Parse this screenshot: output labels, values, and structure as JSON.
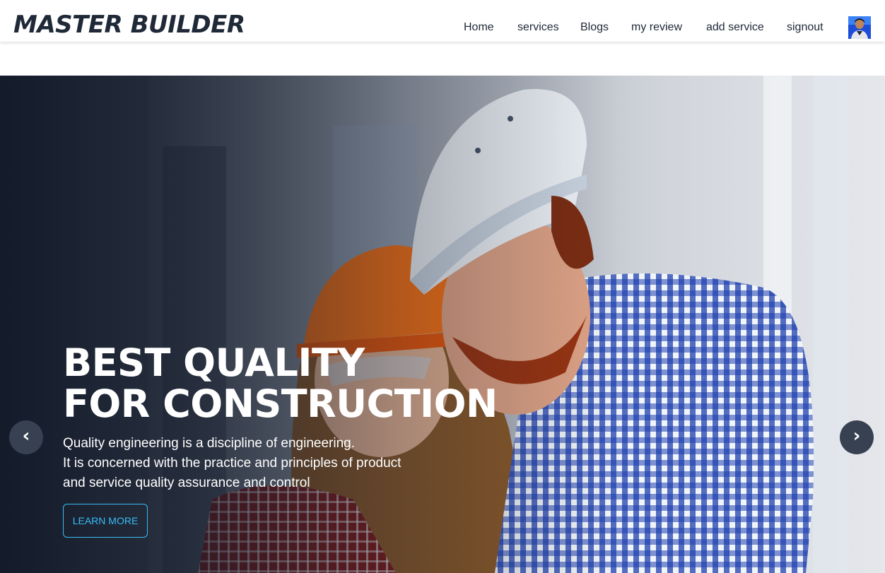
{
  "brand": {
    "name": "MASTER BUILDER"
  },
  "nav": {
    "items": [
      {
        "label": "Home"
      },
      {
        "label": "services"
      },
      {
        "label": "Blogs"
      },
      {
        "label": "my review"
      },
      {
        "label": "add service"
      },
      {
        "label": "signout"
      }
    ]
  },
  "user": {
    "avatar_icon": "user-avatar-photo"
  },
  "hero": {
    "title_line1": "BEST QUALITY",
    "title_line2": "FOR CONSTRUCTION",
    "description_lines": [
      "Quality engineering is a discipline of engineering.",
      "It is concerned with the practice and principles of product",
      "and service quality assurance and control"
    ],
    "cta_label": "LEARN MORE",
    "prev_icon": "‹",
    "next_icon": "›",
    "background_image": "construction-workers-photo"
  },
  "colors": {
    "brand_text": "#1f2937",
    "accent": "#38bdf8",
    "carousel_button": "#374151"
  }
}
